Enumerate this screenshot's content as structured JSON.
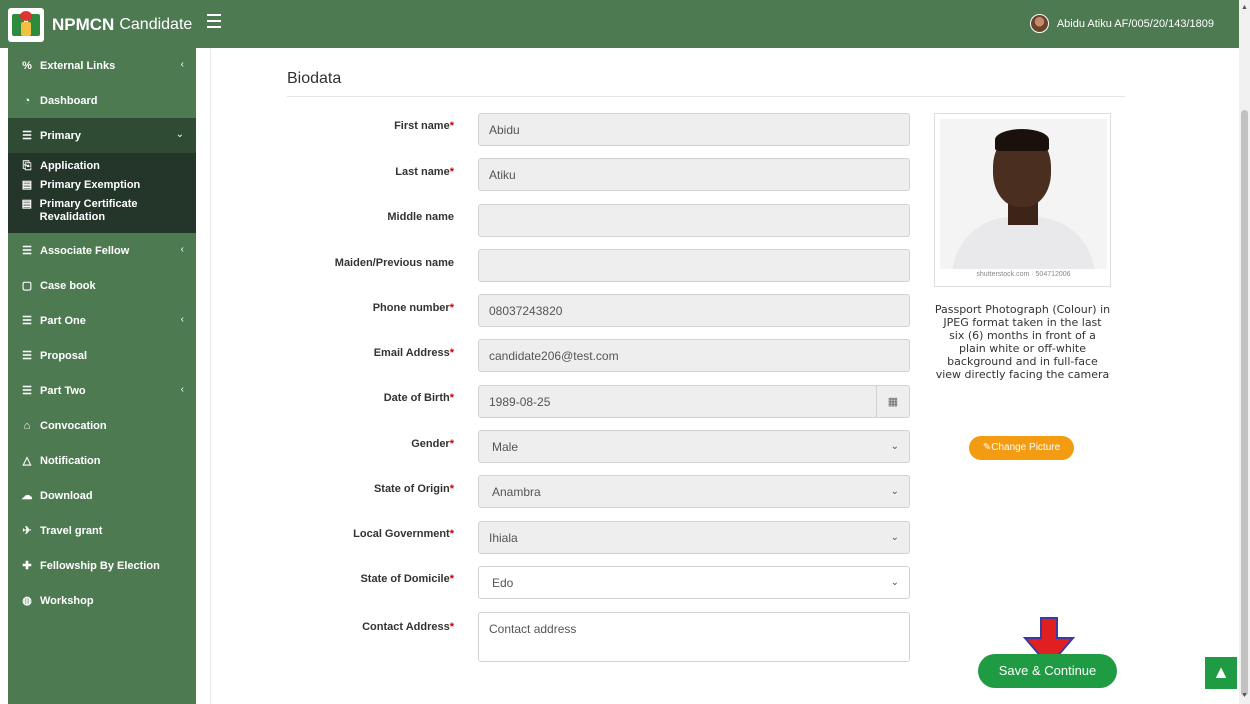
{
  "header": {
    "brand": "NPMCN",
    "brand_suffix": "Candidate",
    "user_label": "Abidu Atiku AF/005/20/143/1809"
  },
  "sidebar": {
    "items": [
      {
        "label": "External Links",
        "icon": "link-icon",
        "chevron": "‹"
      },
      {
        "label": "Dashboard",
        "icon": "dashboard-icon"
      },
      {
        "label": "Primary",
        "icon": "list-icon",
        "chevron": "⌄",
        "active": true,
        "children": [
          {
            "label": "Application",
            "icon": "copy-icon"
          },
          {
            "label": "Primary Exemption",
            "icon": "document-icon"
          },
          {
            "label": "Primary Certificate Revalidation",
            "icon": "document-icon"
          }
        ]
      },
      {
        "label": "Associate Fellow",
        "icon": "list-icon",
        "chevron": "‹"
      },
      {
        "label": "Case book",
        "icon": "file-icon"
      },
      {
        "label": "Part One",
        "icon": "list-icon",
        "chevron": "‹"
      },
      {
        "label": "Proposal",
        "icon": "list-icon"
      },
      {
        "label": "Part Two",
        "icon": "list-icon",
        "chevron": "‹"
      },
      {
        "label": "Convocation",
        "icon": "graduation-cap-icon"
      },
      {
        "label": "Notification",
        "icon": "bell-icon"
      },
      {
        "label": "Download",
        "icon": "cloud-download-icon"
      },
      {
        "label": "Travel grant",
        "icon": "plane-icon"
      },
      {
        "label": "Fellowship By Election",
        "icon": "plus-icon"
      },
      {
        "label": "Workshop",
        "icon": "globe-icon"
      }
    ]
  },
  "form": {
    "title": "Biodata",
    "fields": [
      {
        "label": "First name",
        "required": true,
        "value": "Abidu",
        "type": "text"
      },
      {
        "label": "Last name",
        "required": true,
        "value": "Atiku",
        "type": "text"
      },
      {
        "label": "Middle name",
        "required": false,
        "value": "",
        "type": "text"
      },
      {
        "label": "Maiden/Previous name",
        "required": false,
        "value": "",
        "type": "text"
      },
      {
        "label": "Phone number",
        "required": true,
        "value": "08037243820",
        "type": "text"
      },
      {
        "label": "Email Address",
        "required": true,
        "value": "candidate206@test.com",
        "type": "text"
      },
      {
        "label": "Date of Birth",
        "required": true,
        "value": "1989-08-25",
        "type": "date"
      },
      {
        "label": "Gender",
        "required": true,
        "value": "Male",
        "type": "select"
      },
      {
        "label": "State of Origin",
        "required": true,
        "value": "Anambra",
        "type": "select"
      },
      {
        "label": "Local Government",
        "required": true,
        "value": "Ihiala",
        "type": "select"
      },
      {
        "label": "State of Domicile",
        "required": true,
        "value": "Edo",
        "type": "select-white"
      },
      {
        "label": "Contact Address",
        "required": true,
        "placeholder": "Contact address",
        "type": "textarea"
      }
    ],
    "required_mark": "*"
  },
  "photo": {
    "watermark": "shutterstock.com · 504712006",
    "note": "Passport Photograph (Colour) in JPEG format taken in the last six (6) months in front of a plain white or off-white background and in full-face view directly facing the camera",
    "change_label": "Change Picture"
  },
  "actions": {
    "save_label": "Save & Continue",
    "scroll_top_label": "▲"
  },
  "colors": {
    "header": "#4e7a52",
    "sidebar_active": "#2f4b34",
    "submenu": "#24352a",
    "accent_orange": "#f39c12",
    "accent_green": "#1f9b43",
    "annotation_arrow": "#e02020"
  }
}
